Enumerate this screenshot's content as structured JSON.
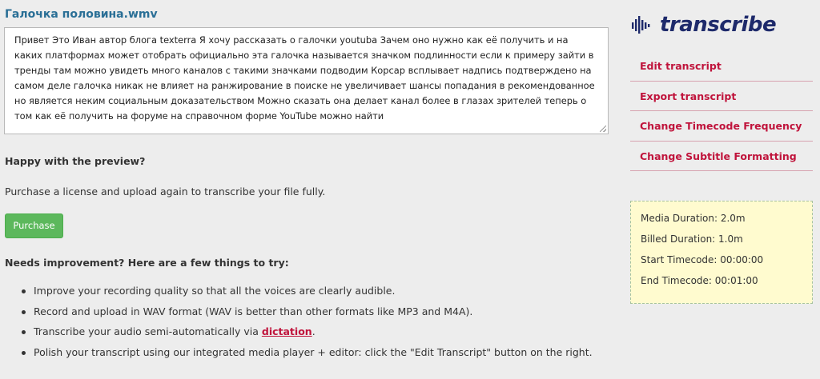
{
  "file": {
    "title": "Галочка половина.wmv"
  },
  "transcript": {
    "text": "Привет Это Иван автор блога texterra Я хочу рассказать о галочки youtuba Зачем оно нужно как её получить и на каких платформах может отобрать официально эта галочка называется значком подлинности если к примеру зайти в тренды там можно увидеть много каналов с такими значками подводим Корсар всплывает надпись подтверждено на самом деле галочка никак не влияет на ранжирование в поиске не увеличивает шансы попадания в рекомендованное но является неким социальным доказательством Можно сказать она делает канал более в глазах зрителей теперь о том как её получить на форуме на справочном форме YouTube можно найти"
  },
  "preview": {
    "happy_heading": "Happy with the preview?",
    "purchase_text": "Purchase a license and upload again to transcribe your file fully.",
    "purchase_button": "Purchase"
  },
  "improvement": {
    "heading": "Needs improvement? Here are a few things to try:",
    "tips": [
      {
        "text": "Improve your recording quality so that all the voices are clearly audible."
      },
      {
        "text": "Record and upload in WAV format (WAV is better than other formats like MP3 and M4A)."
      },
      {
        "text_before": "Transcribe your audio semi-automatically via ",
        "link": "dictation",
        "text_after": "."
      },
      {
        "text": "Polish your transcript using our integrated media player + editor: click the \"Edit Transcript\" button on the right."
      }
    ]
  },
  "brand": {
    "name": "transcribe",
    "color": "#1e2a6b",
    "icon": "waveform-icon"
  },
  "menu": {
    "items": [
      {
        "label": "Edit transcript"
      },
      {
        "label": "Export transcript"
      },
      {
        "label": "Change Timecode Frequency"
      },
      {
        "label": "Change Subtitle Formatting"
      }
    ],
    "color": "#c0143c"
  },
  "info": {
    "media_duration": "Media Duration: 2.0m",
    "billed_duration": "Billed Duration: 1.0m",
    "start_timecode": "Start Timecode: 00:00:00",
    "end_timecode": "End Timecode: 00:01:00"
  },
  "colors": {
    "accent": "#2a6f96",
    "button": "#5cb85c",
    "link": "#c0143c",
    "info_bg": "#fffbcf"
  }
}
